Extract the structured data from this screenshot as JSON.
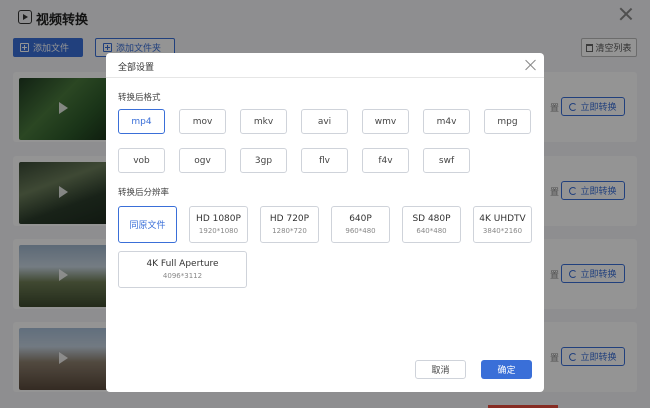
{
  "app": {
    "title": "视频转换"
  },
  "toolbar": {
    "add_file": "添加文件",
    "add_folder": "添加文件夹",
    "clear_list": "清空列表"
  },
  "list": {
    "convert_label": "立即转换",
    "row_trailing_char": "置",
    "rows": [
      {
        "thumb": "forest-video"
      },
      {
        "thumb": "tree-video"
      },
      {
        "thumb": "town-video"
      },
      {
        "thumb": "city-video"
      }
    ]
  },
  "modal": {
    "title": "全部设置",
    "format_section": "转换后格式",
    "formats": [
      "mp4",
      "mov",
      "mkv",
      "avi",
      "wmv",
      "m4v",
      "mpg",
      "vob",
      "ogv",
      "3gp",
      "flv",
      "f4v",
      "swf"
    ],
    "selected_format": "mp4",
    "resolution_section": "转换后分辨率",
    "resolutions": [
      {
        "label": "同原文件",
        "sub": ""
      },
      {
        "label": "HD 1080P",
        "sub": "1920*1080"
      },
      {
        "label": "HD 720P",
        "sub": "1280*720"
      },
      {
        "label": "640P",
        "sub": "960*480"
      },
      {
        "label": "SD 480P",
        "sub": "640*480"
      },
      {
        "label": "4K UHDTV",
        "sub": "3840*2160"
      },
      {
        "label": "4K Full Aperture",
        "sub": "4096*3112"
      }
    ],
    "selected_resolution": "同原文件",
    "cancel": "取消",
    "confirm": "确定"
  },
  "colors": {
    "accent": "#3a6fd8",
    "danger_strip": "#e94d3d"
  }
}
